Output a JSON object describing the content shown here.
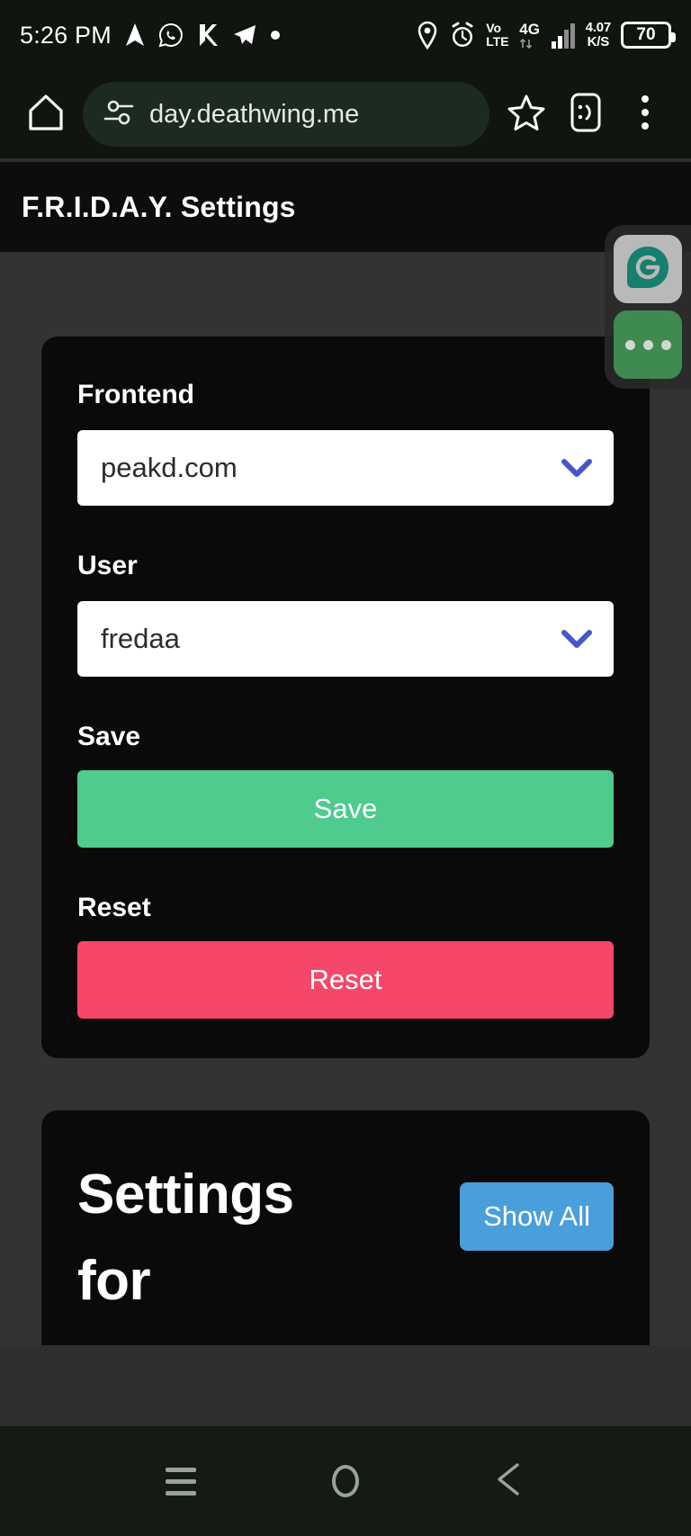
{
  "status_bar": {
    "time": "5:26 PM",
    "left_icons": [
      "navigation-arrow-icon",
      "whatsapp-icon",
      "k9-mail-icon",
      "telegram-icon",
      "dot-icon"
    ],
    "location_icon": "location-pin-icon",
    "alarm_icon": "alarm-clock-icon",
    "volte_line1": "Vo",
    "volte_line2": "LTE",
    "network_type": "4G",
    "signal_icon": "signal-bars-icon",
    "net_speed_value": "4.07",
    "net_speed_unit": "K/S",
    "battery_level": "70"
  },
  "browser": {
    "home_icon": "home-icon",
    "site_settings_icon": "tune-settings-icon",
    "url": "day.deathwing.me",
    "bookmark_icon": "star-icon",
    "tabs_icon": "incognito-tab-icon",
    "menu_icon": "three-dot-menu-icon"
  },
  "page": {
    "title": "F.R.I.D.A.Y. Settings"
  },
  "settings_card": {
    "frontend_label": "Frontend",
    "frontend_value": "peakd.com",
    "user_label": "User",
    "user_value": "fredaa",
    "save_label": "Save",
    "save_button": "Save",
    "reset_label": "Reset",
    "reset_button": "Reset",
    "chevron_icon": "chevron-down-icon"
  },
  "user_settings_card": {
    "heading": "Settings for @fredaa",
    "show_all_button": "Show All"
  },
  "floating_widget": {
    "app_icon": "grammarly-g-icon",
    "more_icon": "more-dots-icon"
  },
  "nav_bar": {
    "recents_icon": "recent-apps-icon",
    "home_icon": "home-circle-icon",
    "back_icon": "back-triangle-icon"
  },
  "colors": {
    "save_green": "#4ECB8D",
    "reset_red": "#F5476A",
    "show_all_blue": "#4A9EDA",
    "chevron_blue": "#4656C8",
    "card_bg": "#0A0A0A",
    "body_bg": "#333333"
  }
}
